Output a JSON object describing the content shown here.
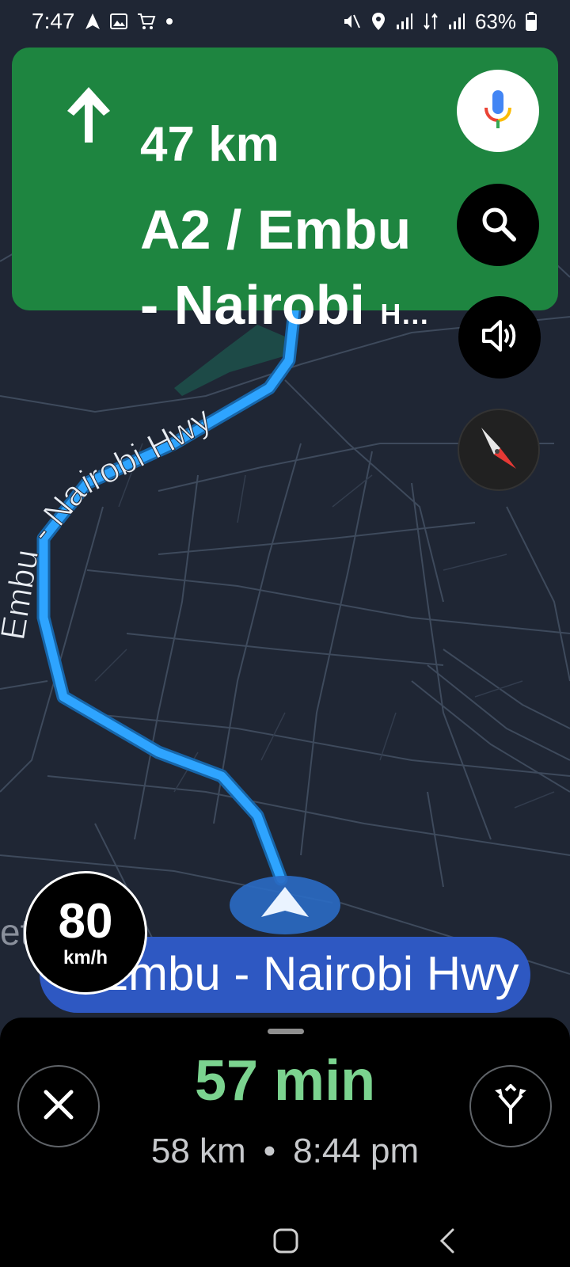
{
  "status_bar": {
    "time": "7:47",
    "battery": "63%",
    "left_icons": [
      "navigation-icon",
      "gallery-icon",
      "shopping-cart-icon",
      "dot-icon"
    ],
    "right_icons": [
      "mute-icon",
      "location-icon",
      "signal-icon",
      "data-icon",
      "signal-icon-2",
      "battery-icon"
    ]
  },
  "navigation": {
    "maneuver_icon": "straight-arrow-icon",
    "distance": "47 km",
    "road_line1": "A2 / Embu",
    "road_line2": "- Nairobi",
    "road_line2_suffix": "H…",
    "color": "#1e8540"
  },
  "actions": {
    "voice_icon": "mic-icon",
    "search_icon": "search-icon",
    "sound_icon": "speaker-icon",
    "compass_icon": "compass-icon"
  },
  "map": {
    "route_label": "Embu - Nairobi Hwy",
    "poi_label": "et Stop",
    "route_color": "#2ea4ff"
  },
  "speed_limit": {
    "value": "80",
    "unit": "km/h"
  },
  "current_road": "Embu - Nairobi Hwy",
  "trip": {
    "eta_duration": "57 min",
    "distance": "58 km",
    "separator": "•",
    "arrival": "8:44 pm",
    "close_icon": "close-icon",
    "alternate_routes_icon": "alternate-routes-icon"
  }
}
